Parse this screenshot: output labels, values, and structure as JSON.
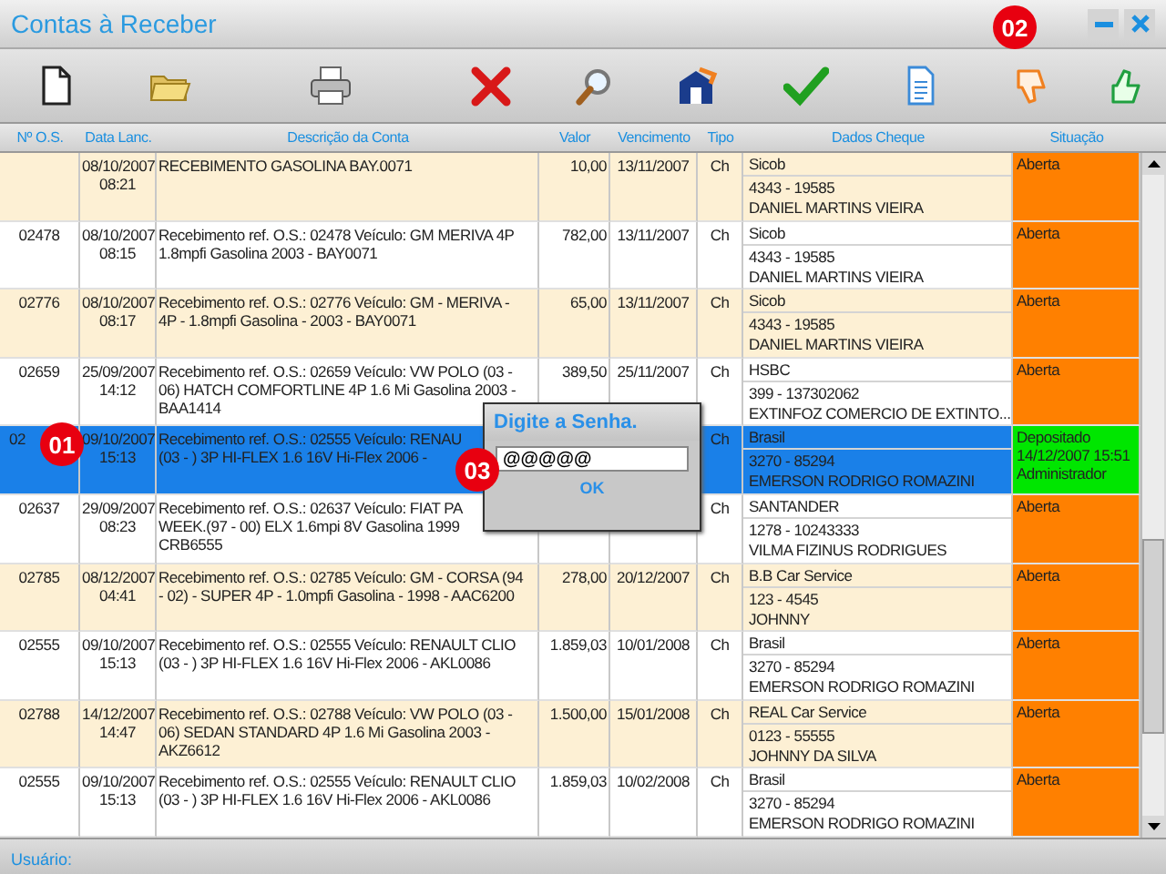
{
  "window": {
    "title": "Contas à Receber"
  },
  "toolbar": {
    "buttons": [
      {
        "kind": "new"
      },
      {
        "kind": "open"
      },
      {
        "kind": "print"
      },
      {
        "kind": "delete"
      },
      {
        "kind": "search"
      },
      {
        "kind": "building"
      },
      {
        "kind": "confirm"
      },
      {
        "kind": "document"
      },
      {
        "kind": "reject"
      },
      {
        "kind": "approve"
      }
    ]
  },
  "table": {
    "columns": [
      "Nº O.S.",
      "Data Lanc.",
      "Descrição da Conta",
      "Valor",
      "Vencimento",
      "Tipo",
      "Dados Cheque",
      "Situação"
    ],
    "rows": [
      {
        "selected": false,
        "os": "",
        "date": "08/10/2007",
        "time": "08:21",
        "description": [
          "RECEBIMENTO GASOLINA BAY.0071"
        ],
        "value": "10,00",
        "due": "13/11/2007",
        "type": "Ch",
        "cheque": [
          "Sicob",
          "4343 - 19585",
          "DANIEL MARTINS VIEIRA"
        ],
        "status": {
          "lines": [
            "Aberta"
          ],
          "color": "#ff8000"
        }
      },
      {
        "selected": false,
        "os": "02478",
        "date": "08/10/2007",
        "time": "08:15",
        "description": [
          "Recebimento ref. O.S.: 02478 Veículo: GM MERIVA 4P",
          "1.8mpfi Gasolina 2003 - BAY0071"
        ],
        "value": "782,00",
        "due": "13/11/2007",
        "type": "Ch",
        "cheque": [
          "Sicob",
          "4343 - 19585",
          "DANIEL MARTINS VIEIRA"
        ],
        "status": {
          "lines": [
            "Aberta"
          ],
          "color": "#ff8000"
        }
      },
      {
        "selected": false,
        "os": "02776",
        "date": "08/10/2007",
        "time": "08:17",
        "description": [
          "Recebimento ref. O.S.: 02776 Veículo: GM - MERIVA -",
          "4P - 1.8mpfi Gasolina - 2003 - BAY0071"
        ],
        "value": "65,00",
        "due": "13/11/2007",
        "type": "Ch",
        "cheque": [
          "Sicob",
          "4343 - 19585",
          "DANIEL MARTINS VIEIRA"
        ],
        "status": {
          "lines": [
            "Aberta"
          ],
          "color": "#ff8000"
        }
      },
      {
        "selected": false,
        "os": "02659",
        "date": "25/09/2007",
        "time": "14:12",
        "description": [
          "Recebimento ref. O.S.: 02659 Veículo: VW POLO (03 -",
          "06) HATCH COMFORTLINE 4P 1.6 Mi Gasolina 2003 -",
          "BAA1414"
        ],
        "value": "389,50",
        "due": "25/11/2007",
        "type": "Ch",
        "cheque": [
          "HSBC",
          "399 - 137302062",
          "EXTINFOZ COMERCIO DE EXTINTO..."
        ],
        "status": {
          "lines": [
            "Aberta"
          ],
          "color": "#ff8000"
        }
      },
      {
        "selected": true,
        "os": "02",
        "date": "09/10/2007",
        "time": "15:13",
        "description": [
          "Recebimento ref. O.S.: 02555 Veículo: RENAU",
          "(03 -  ) 3P HI-FLEX 1.6 16V Hi-Flex 2006 -"
        ],
        "type": "Ch",
        "cheque": [
          "Brasil",
          "3270 - 85294",
          "EMERSON RODRIGO ROMAZINI"
        ],
        "status": {
          "lines": [
            "Depositado",
            "14/12/2007 15:51",
            "Administrador"
          ],
          "color": "#00e600"
        }
      },
      {
        "selected": false,
        "os": "02637",
        "date": "29/09/2007",
        "time": "08:23",
        "description": [
          "Recebimento ref. O.S.: 02637 Veículo: FIAT PA",
          "WEEK.(97 - 00) ELX 1.6mpi 8V Gasolina 1999",
          "CRB6555"
        ],
        "type": "Ch",
        "cheque": [
          "SANTANDER",
          "1278 - 10243333",
          "VILMA FIZINUS RODRIGUES"
        ],
        "status": {
          "lines": [
            "Aberta"
          ],
          "color": "#ff8000"
        }
      },
      {
        "selected": false,
        "os": "02785",
        "date": "08/12/2007",
        "time": "04:41",
        "description": [
          "Recebimento ref. O.S.: 02785 Veículo: GM - CORSA (94",
          "- 02) - SUPER 4P - 1.0mpfi Gasolina - 1998 - AAC6200"
        ],
        "value": "278,00",
        "due": "20/12/2007",
        "type": "Ch",
        "cheque": [
          "B.B Car Service",
          "123 - 4545",
          "JOHNNY"
        ],
        "status": {
          "lines": [
            "Aberta"
          ],
          "color": "#ff8000"
        }
      },
      {
        "selected": false,
        "os": "02555",
        "date": "09/10/2007",
        "time": "15:13",
        "description": [
          "Recebimento ref. O.S.: 02555 Veículo: RENAULT CLIO",
          "(03 -  ) 3P HI-FLEX 1.6 16V Hi-Flex 2006 - AKL0086"
        ],
        "value": "1.859,03",
        "due": "10/01/2008",
        "type": "Ch",
        "cheque": [
          "Brasil",
          "3270 - 85294",
          "EMERSON RODRIGO ROMAZINI"
        ],
        "status": {
          "lines": [
            "Aberta"
          ],
          "color": "#ff8000"
        }
      },
      {
        "selected": false,
        "os": "02788",
        "date": "14/12/2007",
        "time": "14:47",
        "description": [
          "Recebimento ref. O.S.: 02788 Veículo: VW POLO (03 -",
          "06) SEDAN STANDARD 4P 1.6 Mi Gasolina 2003 -",
          "AKZ6612"
        ],
        "value": "1.500,00",
        "due": "15/01/2008",
        "type": "Ch",
        "cheque": [
          "REAL Car Service",
          "0123 - 55555",
          "JOHNNY DA SILVA"
        ],
        "status": {
          "lines": [
            "Aberta"
          ],
          "color": "#ff8000"
        }
      },
      {
        "selected": false,
        "os": "02555",
        "date": "09/10/2007",
        "time": "15:13",
        "description": [
          "Recebimento ref. O.S.: 02555 Veículo: RENAULT CLIO",
          "(03 -  ) 3P HI-FLEX 1.6 16V Hi-Flex 2006 - AKL0086"
        ],
        "value": "1.859,03",
        "due": "10/02/2008",
        "type": "Ch",
        "cheque": [
          "Brasil",
          "3270 - 85294",
          "EMERSON RODRIGO ROMAZINI"
        ],
        "status": {
          "lines": [
            "Aberta"
          ],
          "color": "#ff8000"
        }
      }
    ]
  },
  "dialog": {
    "title": "Digite a Senha.",
    "value": "@@@@@",
    "button": "OK"
  },
  "markers": [
    {
      "label": "01"
    },
    {
      "label": "02"
    },
    {
      "label": "03"
    }
  ],
  "status_bar": {
    "label": "Usuário:"
  }
}
